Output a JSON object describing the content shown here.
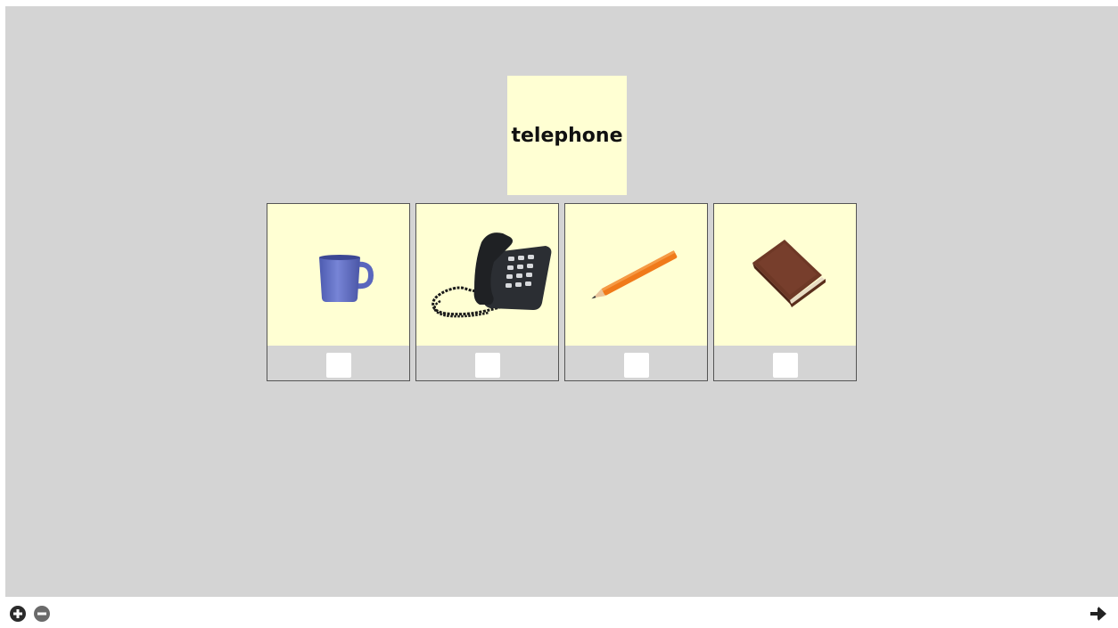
{
  "prompt": {
    "word": "telephone"
  },
  "choices": [
    {
      "icon": "cup-icon"
    },
    {
      "icon": "telephone-icon"
    },
    {
      "icon": "pencil-icon"
    },
    {
      "icon": "book-icon"
    }
  ],
  "colors": {
    "stage_bg": "#d4d4d4",
    "card_bg": "#ffffd3",
    "checkbox_bg": "#ffffff",
    "card_border": "#555555"
  },
  "toolbar": {
    "zoom_in_icon": "plus-circle-icon",
    "zoom_out_icon": "minus-circle-icon",
    "next_icon": "arrow-right-icon"
  }
}
